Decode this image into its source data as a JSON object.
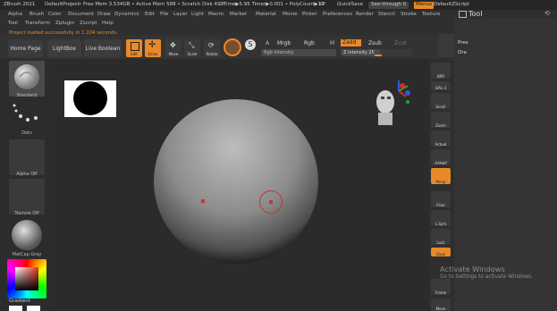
{
  "titlebar": {
    "app": "ZBrush 2021",
    "project": "DefaultProject",
    "mem": "• Free Mem 3.534GB • Active Mem 588 • Scratch Disk 49 •",
    "ztime": "ZTime▶5.95 Timer▶0.001 • PolyCount▶11",
    "kp": "KP",
    "quicksave": "QuickSave",
    "seethrough": "See-through 0",
    "menus": "Menus",
    "script": "DefaultZScript"
  },
  "menu_row1": [
    "Alpha",
    "Brush",
    "Color",
    "Document",
    "Draw",
    "Dynamics",
    "Edit",
    "File",
    "Layer",
    "Light",
    "Macro",
    "Marker",
    "Material",
    "Movie",
    "Picker",
    "Preferences",
    "Render",
    "Stencil",
    "Stroke",
    "Texture"
  ],
  "menu_row2": [
    "Tool",
    "Transform",
    "Zplugin",
    "Zscript",
    "Help"
  ],
  "status": "Project loaded successfully in 1.204 seconds.",
  "toolpanel": {
    "title": "Tool",
    "copy_icon": "copy-icon",
    "restore_icon": "restore-icon",
    "row1": "Pres",
    "row2": "Dra"
  },
  "shelf": {
    "home": "Home Page",
    "lightbox": "LightBox",
    "livebool": "Live Boolean",
    "edit": "Edit",
    "draw": "Draw",
    "move": "Move",
    "scale": "Scale",
    "rotate": "Rotate",
    "a": "A",
    "mrgb": "Mrgb",
    "rgb": "Rgb",
    "m": "M",
    "rgb_intensity": "Rgb Intensity",
    "zadd": "Zadd",
    "zsub": "Zsub",
    "zcut": "Zcut",
    "z_intensity": "Z Intensity 25",
    "z_intensity_value": 0.25
  },
  "lefttray": {
    "standard": "Standard",
    "dots": "Dots",
    "alpha_off": "Alpha Off",
    "texture_off": "Texture Off",
    "matcap": "MatCap Gray",
    "gradient": "Gradient"
  },
  "righttray": [
    {
      "label": "BPR"
    },
    {
      "label": "SPix 3"
    },
    {
      "label": "Scroll"
    },
    {
      "label": "Zoom"
    },
    {
      "label": "Actual"
    },
    {
      "label": "AAHalf"
    },
    {
      "label": "Persp",
      "active": true
    },
    {
      "label": "Floor"
    },
    {
      "label": "L.Sym"
    },
    {
      "label": "Lock"
    },
    {
      "label": "Qxyz",
      "active": true
    },
    {
      "label": "Frame"
    },
    {
      "label": "Move"
    }
  ],
  "watermark": {
    "title": "Activate Windows",
    "subtitle": "Go to Settings to activate Windows."
  },
  "colors": {
    "accent": "#e8892a",
    "bg": "#2f2f2f"
  }
}
